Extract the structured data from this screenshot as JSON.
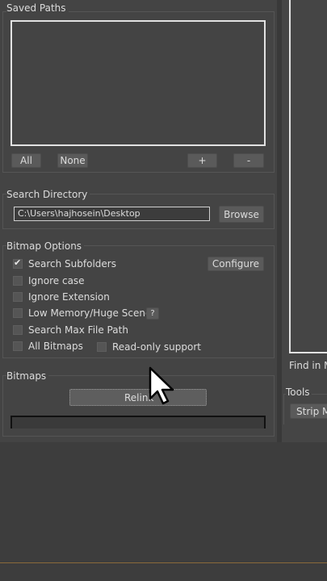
{
  "saved_paths": {
    "title": "Saved Paths",
    "all_label": "All",
    "none_label": "None",
    "add_label": "+",
    "remove_label": "-"
  },
  "search_directory": {
    "title": "Search Directory",
    "path_value": "C:\\Users\\hajhosein\\Desktop",
    "browse_label": "Browse"
  },
  "bitmap_options": {
    "title": "Bitmap Options",
    "configure_label": "Configure",
    "help_label": "?",
    "options": [
      {
        "label": "Search Subfolders",
        "checked": true
      },
      {
        "label": "Ignore case",
        "checked": false
      },
      {
        "label": "Ignore Extension",
        "checked": false
      },
      {
        "label": "Low Memory/Huge Scene",
        "checked": false
      },
      {
        "label": "Search Max File Path",
        "checked": false
      },
      {
        "label": "All Bitmaps",
        "checked": false
      },
      {
        "label": "Read-only support",
        "checked": false
      }
    ]
  },
  "bitmaps": {
    "title": "Bitmaps",
    "relink_label": "Relink"
  },
  "right_panel": {
    "find_label": "Find in M",
    "tools_title": "Tools",
    "strip_label": "Strip M"
  }
}
